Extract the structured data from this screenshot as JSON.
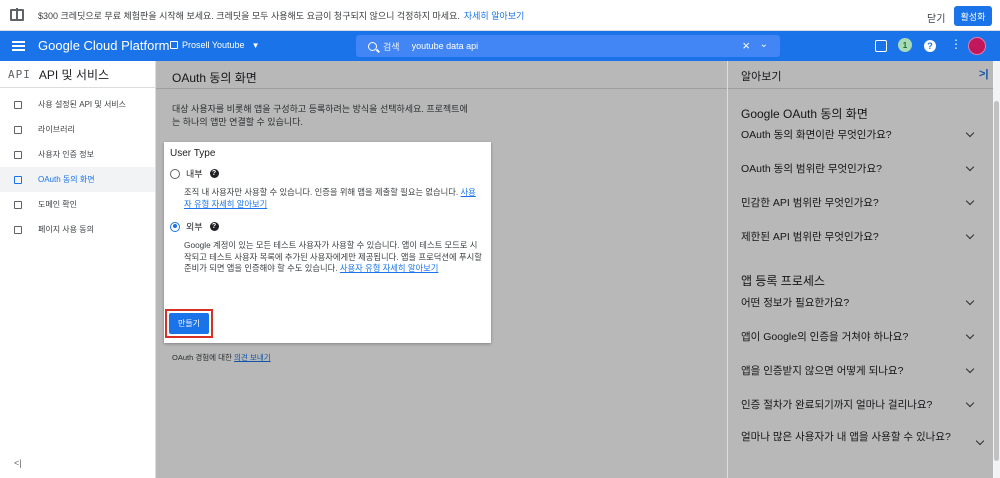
{
  "promo": {
    "text": "$300 크레딧으로 무료 체험판을 시작해 보세요. 크레딧을 모두 사용해도 요금이 청구되지 않으니 걱정하지 마세요.",
    "link": "자세히 알아보기",
    "close": "닫기",
    "activate": "활성화"
  },
  "topbar": {
    "title": "Google Cloud Platform",
    "project": "Prosell Youtube",
    "search_label": "검색",
    "search_value": "youtube data api",
    "badge": "1",
    "help": "?"
  },
  "leftnav": {
    "logo": "API",
    "title": "API 및 서비스",
    "items": [
      {
        "label": "사용 설정된 API 및 서비스",
        "icon": "api-diamond-icon"
      },
      {
        "label": "라이브러리",
        "icon": "library-icon"
      },
      {
        "label": "사용자 인증 정보",
        "icon": "key-icon"
      },
      {
        "label": "OAuth 동의 화면",
        "icon": "consent-icon"
      },
      {
        "label": "도메인 확인",
        "icon": "domain-icon"
      },
      {
        "label": "페이지 사용 동의",
        "icon": "page-agreement-icon"
      }
    ],
    "collapse": "<|"
  },
  "main": {
    "title": "OAuth 동의 화면",
    "desc": "대상 사용자를 비롯해 앱을 구성하고 등록하려는 방식을 선택하세요. 프로젝트에는 하나의 앱만 연결할 수 있습니다.",
    "feedback_prefix": "OAuth 경험에 대한",
    "feedback_link": "의견 보내기"
  },
  "dialog": {
    "user_type": "User Type",
    "internal": {
      "label": "내부",
      "desc": "조직 내 사용자만 사용할 수 있습니다. 인증을 위해 앱을 제출할 필요는 없습니다.",
      "link": "사용자 유형 자세히 알아보기"
    },
    "external": {
      "label": "외부",
      "desc": "Google 계정이 있는 모든 테스트 사용자가 사용할 수 있습니다. 앱이 테스트 모드로 시작되고 테스트 사용자 목록에 추가된 사용자에게만 제공됩니다. 앱을 프로덕션에 푸시할 준비가 되면 앱을 인증해야 할 수도 있습니다.",
      "link": "사용자 유형 자세히 알아보기"
    },
    "selected": "external",
    "create": "만들기"
  },
  "rightpanel": {
    "title": "알아보기",
    "collapse": ">|",
    "section1": "Google OAuth 동의 화면",
    "items1": [
      "OAuth 동의 화면이란 무엇인가요?",
      "OAuth 동의 범위란 무엇인가요?",
      "민감한 API 범위란 무엇인가요?",
      "제한된 API 범위란 무엇인가요?"
    ],
    "section2": "앱 등록 프로세스",
    "items2": [
      "어떤 정보가 필요한가요?",
      "앱이 Google의 인증을 거쳐야 하나요?",
      "앱을 인증받지 않으면 어떻게 되나요?",
      "인증 절차가 완료되기까지 얼마나 걸리나요?",
      "얼마나 많은 사용자가 내 앱을 사용할 수 있나요?"
    ]
  }
}
